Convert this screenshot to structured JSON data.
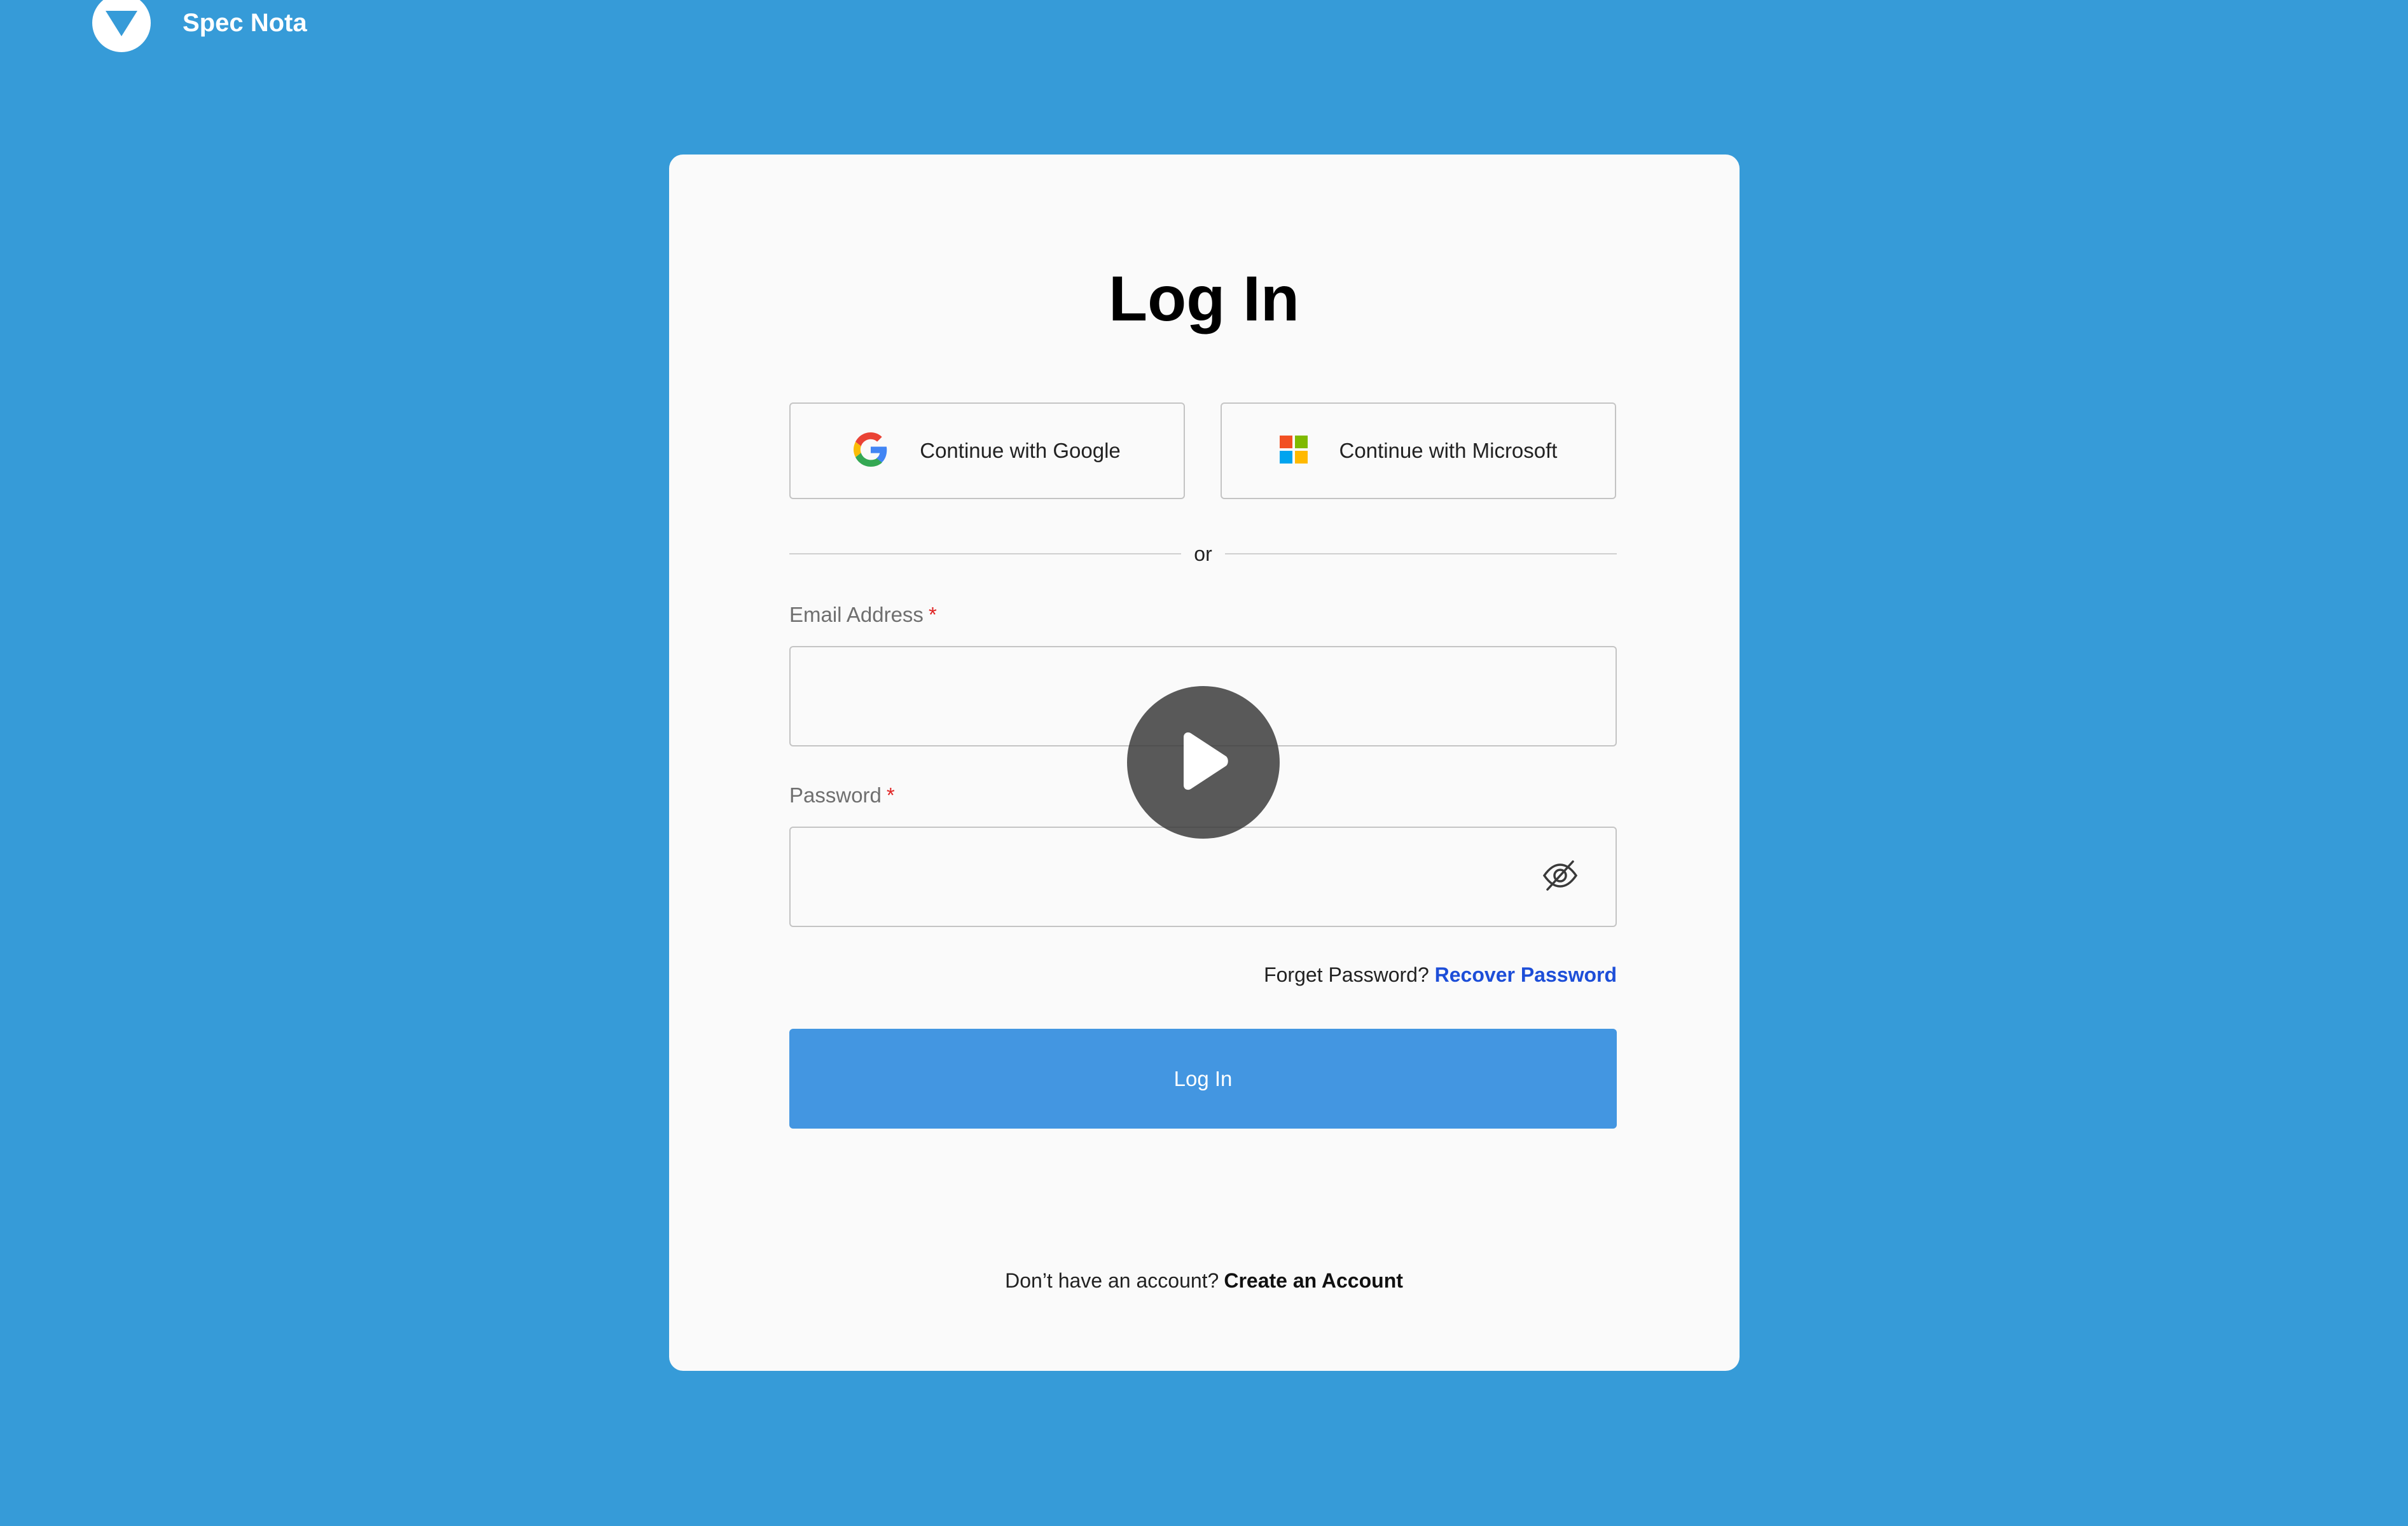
{
  "brand": {
    "name": "Spec Nota"
  },
  "login": {
    "title": "Log In",
    "google_label": "Continue with Google",
    "microsoft_label": "Continue with Microsoft",
    "divider_text": "or",
    "email_label": "Email Address",
    "email_required": "*",
    "email_value": "",
    "password_label": "Password",
    "password_required": "*",
    "password_value": "",
    "forgot_text": "Forget Password?",
    "recover_link": "Recover Password",
    "submit_label": "Log In",
    "signup_text": "Don’t have an account?",
    "signup_link": "Create an Account"
  },
  "colors": {
    "background": "#369bd8",
    "primary_button": "#4396e1",
    "link": "#1d4ed8",
    "required": "#e02424"
  },
  "icons": {
    "brand_logo": "triangle-down-logo-icon",
    "google": "google-icon",
    "microsoft": "microsoft-icon",
    "password_toggle": "eye-off-icon",
    "video_overlay": "play-icon"
  }
}
